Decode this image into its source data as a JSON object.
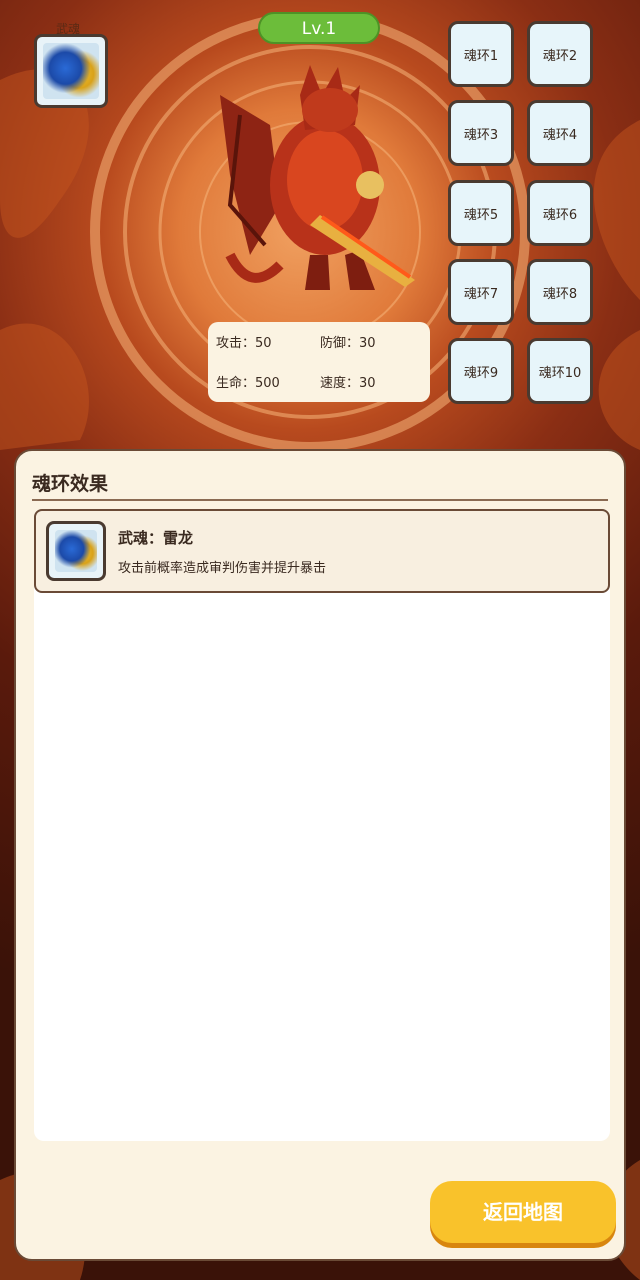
{
  "header": {
    "level_label": "Lv.1"
  },
  "weapon_soul": {
    "label": "武魂",
    "icon": "thunder-dragon-icon"
  },
  "soul_rings": [
    "魂环1",
    "魂环2",
    "魂环3",
    "魂环4",
    "魂环5",
    "魂环6",
    "魂环7",
    "魂环8",
    "魂环9",
    "魂环10"
  ],
  "stats": {
    "attack_label": "攻击：50",
    "defense_label": "防御：30",
    "hp_label": "生命：500",
    "speed_label": "速度：30"
  },
  "panel": {
    "title": "魂环效果",
    "effects": [
      {
        "name": "武魂：雷龙",
        "desc": "攻击前概率造成审判伤害并提升暴击",
        "icon": "thunder-dragon-icon"
      }
    ],
    "back_label": "返回地图"
  },
  "colors": {
    "level_green": "#6cbd3a",
    "button_yellow": "#f9c22b",
    "panel_bg": "#fbf3e2"
  }
}
